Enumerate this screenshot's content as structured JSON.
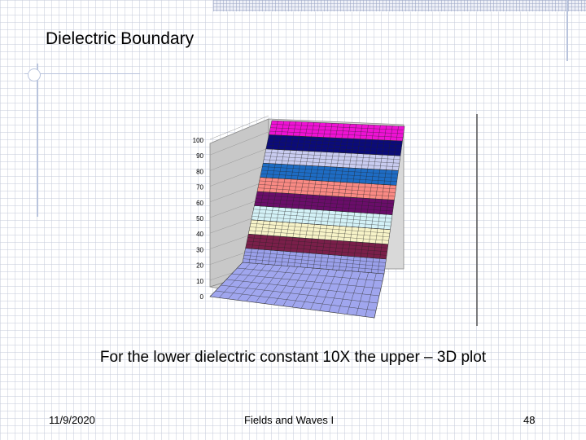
{
  "slide": {
    "title": "Dielectric Boundary",
    "caption": "For the lower dielectric constant 10X the upper – 3D plot",
    "footer": {
      "date": "11/9/2020",
      "course": "Fields and Waves I",
      "page": "48"
    }
  },
  "chart_data": {
    "type": "surface",
    "title": "",
    "xlabel": "",
    "ylabel": "",
    "zlim": [
      0,
      100
    ],
    "z_ticks": [
      0,
      10,
      20,
      30,
      40,
      50,
      60,
      70,
      80,
      90,
      100
    ],
    "description_values": {
      "lower_region_value": 0,
      "upper_region_max": 100
    },
    "bands": [
      {
        "from": 0,
        "to": 10,
        "color": "#9aa0ea"
      },
      {
        "from": 10,
        "to": 20,
        "color": "#7a1f4a"
      },
      {
        "from": 20,
        "to": 30,
        "color": "#f7f3c8"
      },
      {
        "from": 30,
        "to": 40,
        "color": "#d4f2f7"
      },
      {
        "from": 40,
        "to": 50,
        "color": "#6a0d6a"
      },
      {
        "from": 50,
        "to": 60,
        "color": "#f98a84"
      },
      {
        "from": 60,
        "to": 70,
        "color": "#1e6cc4"
      },
      {
        "from": 70,
        "to": 80,
        "color": "#c9ccf0"
      },
      {
        "from": 80,
        "to": 90,
        "color": "#0b0b7a"
      },
      {
        "from": 90,
        "to": 100,
        "color": "#ee12d4"
      }
    ],
    "wall_color": "#c8c8c8",
    "floor_color": "#a0a6ee",
    "grid": true
  }
}
